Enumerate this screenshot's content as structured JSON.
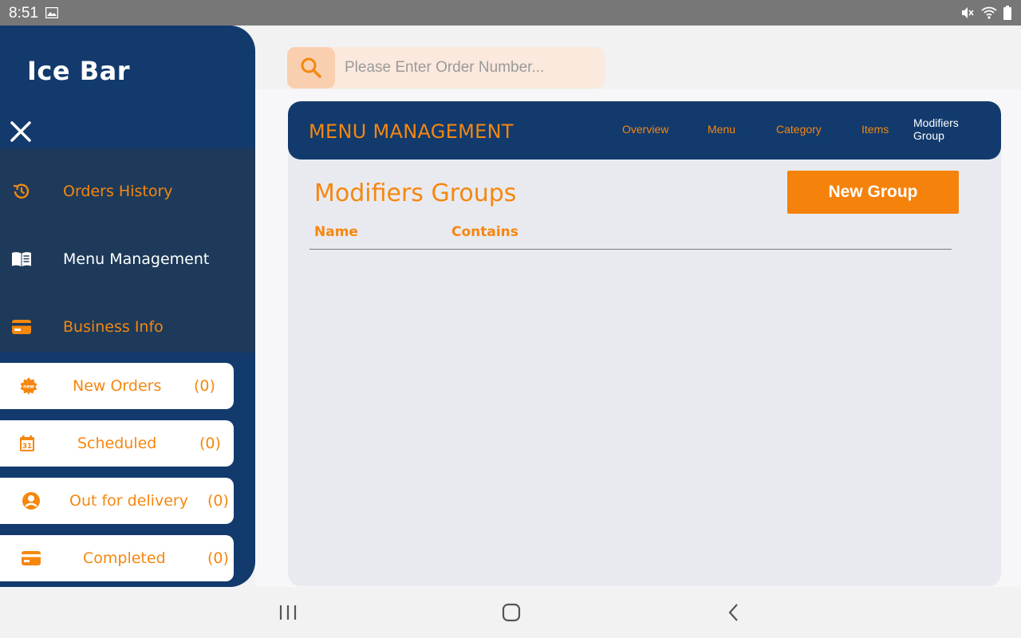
{
  "status_bar": {
    "time": "8:51"
  },
  "sidebar": {
    "brand": "Ice Bar",
    "nav": [
      {
        "label": "Orders History",
        "icon": "history-icon",
        "color": "#f5870f"
      },
      {
        "label": "Menu Management",
        "icon": "book-open-icon",
        "color": "#ffffff"
      },
      {
        "label": "Business Info",
        "icon": "credit-card-icon",
        "color": "#f5870f"
      }
    ],
    "status_cards": [
      {
        "label": "New Orders",
        "count": "(0)",
        "icon": "new-badge-icon"
      },
      {
        "label": "Scheduled",
        "count": "(0)",
        "icon": "calendar-icon"
      },
      {
        "label": "Out for delivery",
        "count": "(0)",
        "icon": "person-icon"
      },
      {
        "label": "Completed",
        "count": "(0)",
        "icon": "credit-card-icon"
      }
    ]
  },
  "search": {
    "placeholder": "Please Enter Order Number..."
  },
  "header": {
    "title": "MENU MANAGEMENT",
    "tabs": [
      {
        "label": "Overview",
        "active": false
      },
      {
        "label": "Menu",
        "active": false
      },
      {
        "label": "Category",
        "active": false
      },
      {
        "label": "Items",
        "active": false
      },
      {
        "label": "Modifiers Group",
        "active": true
      }
    ]
  },
  "main": {
    "section_title": "Modifiers Groups",
    "new_group_label": "New Group",
    "columns": [
      "Name",
      "Contains"
    ]
  },
  "colors": {
    "navy": "#123a6d",
    "orange": "#f5870f",
    "nav_block": "#1d3a5a"
  }
}
